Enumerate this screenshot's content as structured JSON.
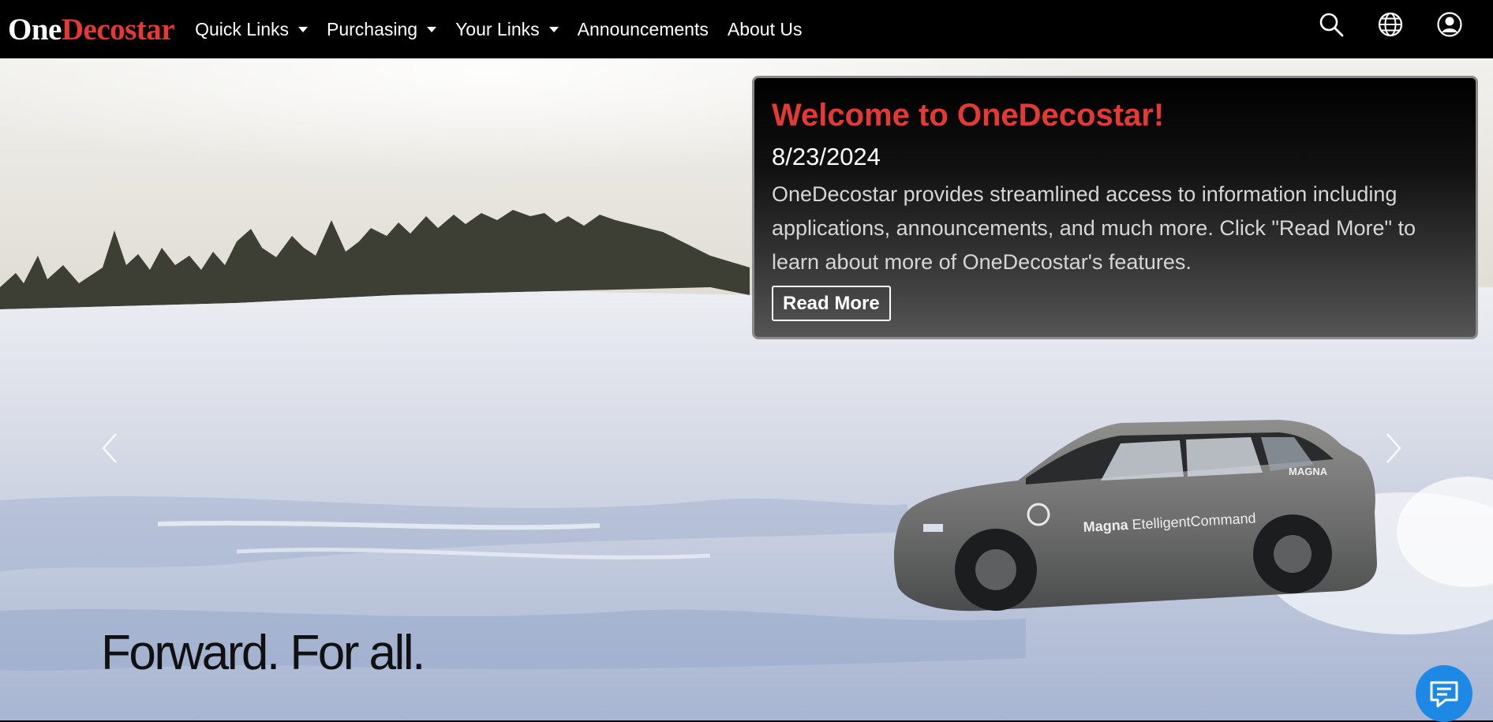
{
  "brand": {
    "part1": "One",
    "part2": "Decostar"
  },
  "nav": {
    "items": [
      {
        "label": "Quick Links",
        "dropdown": true
      },
      {
        "label": "Purchasing",
        "dropdown": true
      },
      {
        "label": "Your Links",
        "dropdown": true
      },
      {
        "label": "Announcements",
        "dropdown": false
      },
      {
        "label": "About Us",
        "dropdown": false
      }
    ],
    "icons": [
      "search-icon",
      "globe-icon",
      "user-account-icon"
    ]
  },
  "hero": {
    "tagline": "Forward. For all.",
    "car_text": {
      "brand": "Magna",
      "product": "EtelligentCommand",
      "badge": "MAGNA"
    }
  },
  "announcement": {
    "title": "Welcome to OneDecostar!",
    "date": "8/23/2024",
    "text": "OneDecostar provides streamlined access to information including applications, announcements, and much more. Click \"Read More\" to learn about more of OneDecostar's features.",
    "button": "Read More"
  },
  "chat": {
    "icon": "chat-icon"
  },
  "colors": {
    "brand_red": "#e53935",
    "nav_bg": "#000000",
    "chat_blue": "#1e88e5"
  }
}
